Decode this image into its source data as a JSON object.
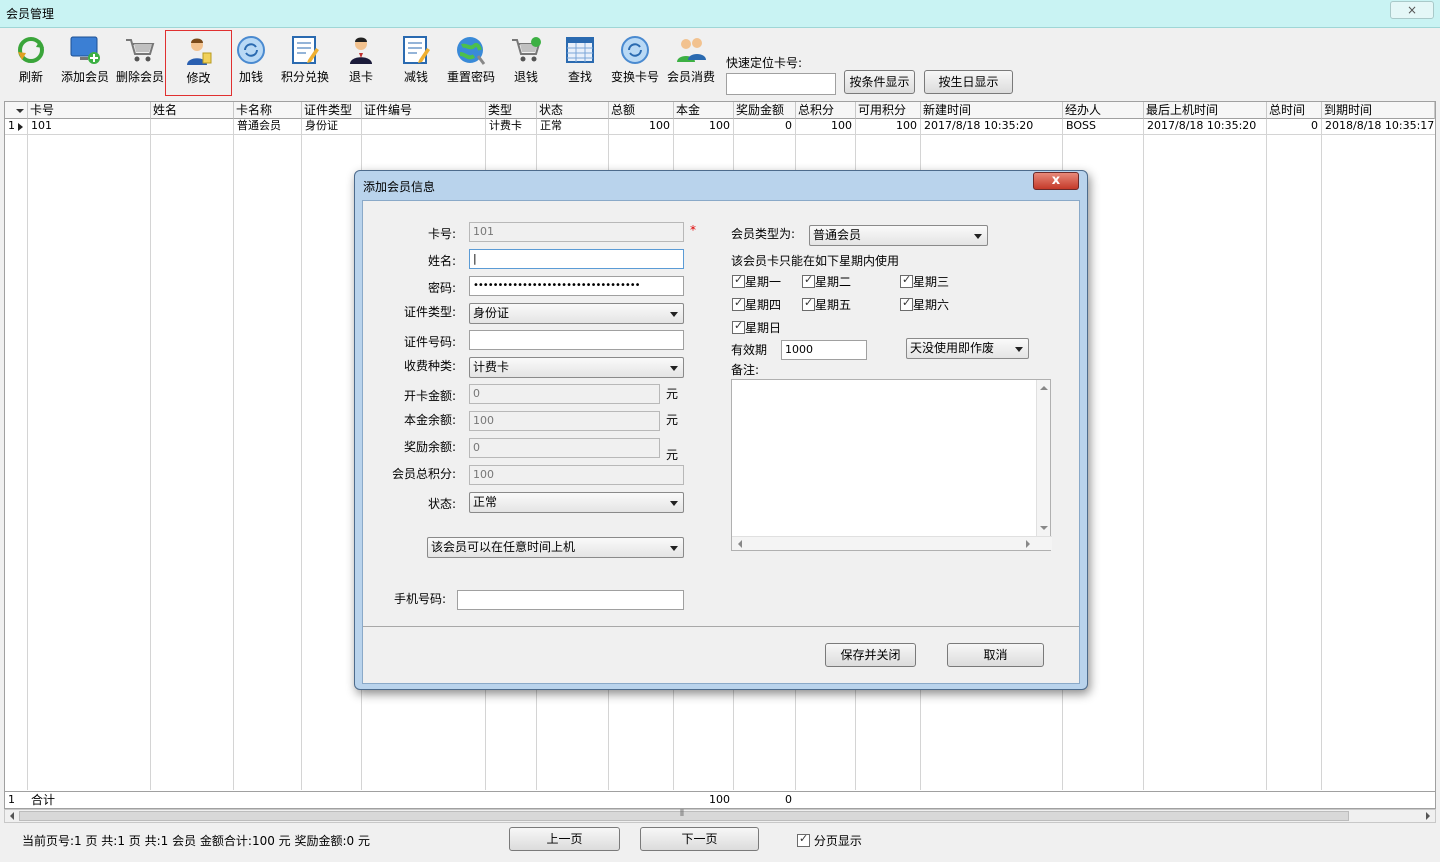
{
  "window": {
    "title": "会员管理",
    "close": "×"
  },
  "toolbar": {
    "buttons": [
      {
        "label": "刷新",
        "icon": "refresh-icon"
      },
      {
        "label": "添加会员",
        "icon": "add-member-icon"
      },
      {
        "label": "删除会员",
        "icon": "cart-delete-icon"
      },
      {
        "label": "修改",
        "icon": "edit-member-icon"
      },
      {
        "label": "加钱",
        "icon": "add-money-icon"
      },
      {
        "label": "积分兑换",
        "icon": "points-exchange-icon"
      },
      {
        "label": "退卡",
        "icon": "return-card-icon"
      },
      {
        "label": "减钱",
        "icon": "subtract-money-icon"
      },
      {
        "label": "重置密码",
        "icon": "reset-password-icon"
      },
      {
        "label": "退钱",
        "icon": "refund-icon"
      },
      {
        "label": "查找",
        "icon": "search-icon"
      },
      {
        "label": "变换卡号",
        "icon": "change-card-icon"
      },
      {
        "label": "会员消费",
        "icon": "member-consume-icon"
      }
    ],
    "quick_locate_label": "快速定位卡号:",
    "filter_button": "按条件显示",
    "birthday_button": "按生日显示"
  },
  "grid": {
    "columns": [
      "卡号",
      "姓名",
      "卡名称",
      "证件类型",
      "证件编号",
      "类型",
      "状态",
      "总额",
      "本金",
      "奖励金额",
      "总积分",
      "可用积分",
      "新建时间",
      "经办人",
      "最后上机时间",
      "总时间",
      "到期时间"
    ],
    "rows": [
      {
        "index": "1",
        "cells": [
          "101",
          "",
          "普通会员",
          "身份证",
          "",
          "计费卡",
          "正常",
          "100",
          "100",
          "0",
          "100",
          "100",
          "2017/8/18 10:35:20",
          "BOSS",
          "2017/8/18 10:35:20",
          "0",
          "2018/8/18 10:35:17"
        ]
      }
    ],
    "summary": {
      "index": "1",
      "label": "合计",
      "base_total": "100",
      "bonus_total": "0"
    },
    "scroll_grip": "⦀"
  },
  "status": {
    "text": "当前页号:1 页 共:1 页 共:1 会员 金额合计:100 元 奖励金额:0 元",
    "prev": "上一页",
    "next": "下一页",
    "paging_label": "分页显示"
  },
  "dialog": {
    "title": "添加会员信息",
    "close": "x",
    "card_no_label": "卡号:",
    "card_no_value": "101",
    "required_mark": "*",
    "name_label": "姓名:",
    "name_value": "|",
    "password_label": "密码:",
    "password_value": "••••••••••••••••••••••••••••••••••",
    "id_type_label": "证件类型:",
    "id_type_value": "身份证",
    "id_no_label": "证件号码:",
    "fee_type_label": "收费种类:",
    "fee_type_value": "计费卡",
    "open_amount_label": "开卡金额:",
    "open_amount_value": "0",
    "base_balance_label": "本金余额:",
    "base_balance_value": "100",
    "bonus_balance_label": "奖励余额:",
    "bonus_balance_value": "0",
    "total_points_label": "会员总积分:",
    "total_points_value": "100",
    "status_label": "状态:",
    "status_value": "正常",
    "time_rule_value": "该会员可以在任意时间上机",
    "phone_label": "手机号码:",
    "unit": "元",
    "member_type_label": "会员类型为:",
    "member_type_value": "普通会员",
    "weekday_note": "该会员卡只能在如下星期内使用",
    "weekdays": [
      "星期一",
      "星期二",
      "星期三",
      "星期四",
      "星期五",
      "星期六",
      "星期日"
    ],
    "valid_label": "有效期",
    "valid_value": "1000",
    "valid_rule": "天没使用即作废",
    "remark_label": "备注:",
    "save_button": "保存并关闭",
    "cancel_button": "取消"
  }
}
